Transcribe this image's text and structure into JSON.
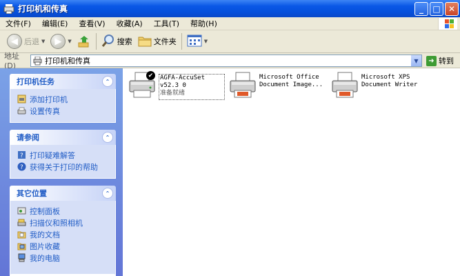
{
  "window": {
    "title": "打印机和传真"
  },
  "menu": [
    "文件(F)",
    "编辑(E)",
    "查看(V)",
    "收藏(A)",
    "工具(T)",
    "帮助(H)"
  ],
  "toolbar": {
    "back_label": "后退",
    "search_label": "搜索",
    "folders_label": "文件夹"
  },
  "address": {
    "label": "地址(D)",
    "value": "打印机和传真",
    "go_label": "转到"
  },
  "tasks": {
    "printer_tasks": {
      "title": "打印机任务",
      "items": [
        "添加打印机",
        "设置传真"
      ]
    },
    "see_also": {
      "title": "请参阅",
      "items": [
        "打印疑难解答",
        "获得关于打印的帮助"
      ]
    },
    "other_places": {
      "title": "其它位置",
      "items": [
        "控制面板",
        "扫描仪和照相机",
        "我的文档",
        "图片收藏",
        "我的电脑"
      ]
    }
  },
  "printers": [
    {
      "name": "AGFA-AccuSet v52.3 0",
      "status": "准备就绪",
      "default": true
    },
    {
      "name": "Microsoft Office Document Image...",
      "status": ""
    },
    {
      "name": "Microsoft XPS Document Writer",
      "status": ""
    }
  ],
  "colors": {
    "title_bar": "#0a58e6",
    "task_pane": "#6f8fe0",
    "link": "#215dc6"
  }
}
